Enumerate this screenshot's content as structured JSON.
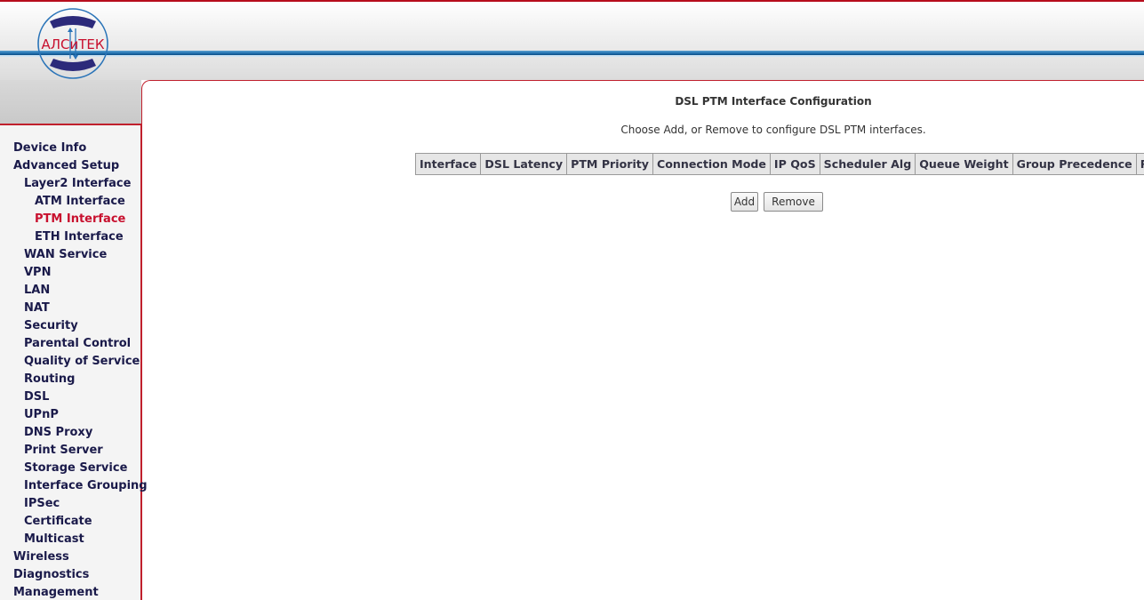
{
  "logo": {
    "text": "АЛСиТЕК",
    "icon": "telephone-handset-logo"
  },
  "colors": {
    "brand_red": "#c0202d",
    "stripe_blue": "#1f6fae",
    "menu_text": "#1a1a4a",
    "menu_active": "#c8102e"
  },
  "menu": {
    "items": [
      {
        "label": "Device Info",
        "level": 1
      },
      {
        "label": "Advanced Setup",
        "level": 1
      },
      {
        "label": "Layer2 Interface",
        "level": 2
      },
      {
        "label": "ATM Interface",
        "level": 3
      },
      {
        "label": "PTM Interface",
        "level": 3,
        "active": true
      },
      {
        "label": "ETH Interface",
        "level": 3
      },
      {
        "label": "WAN Service",
        "level": 2
      },
      {
        "label": "VPN",
        "level": 2
      },
      {
        "label": "LAN",
        "level": 2
      },
      {
        "label": "NAT",
        "level": 2
      },
      {
        "label": "Security",
        "level": 2
      },
      {
        "label": "Parental Control",
        "level": 2
      },
      {
        "label": "Quality of Service",
        "level": 2
      },
      {
        "label": "Routing",
        "level": 2
      },
      {
        "label": "DSL",
        "level": 2
      },
      {
        "label": "UPnP",
        "level": 2
      },
      {
        "label": "DNS Proxy",
        "level": 2
      },
      {
        "label": "Print Server",
        "level": 2
      },
      {
        "label": "Storage Service",
        "level": 2
      },
      {
        "label": "Interface Grouping",
        "level": 2
      },
      {
        "label": "IPSec",
        "level": 2
      },
      {
        "label": "Certificate",
        "level": 2
      },
      {
        "label": "Multicast",
        "level": 2
      },
      {
        "label": "Wireless",
        "level": 1
      },
      {
        "label": "Diagnostics",
        "level": 1
      },
      {
        "label": "Management",
        "level": 1
      }
    ]
  },
  "main": {
    "title": "DSL PTM Interface Configuration",
    "description": "Choose Add, or Remove to configure DSL PTM interfaces.",
    "table": {
      "columns": [
        "Interface",
        "DSL Latency",
        "PTM Priority",
        "Connection Mode",
        "IP QoS",
        "Scheduler Alg",
        "Queue Weight",
        "Group Precedence",
        "Remove"
      ],
      "rows": []
    },
    "buttons": {
      "add": "Add",
      "remove": "Remove"
    }
  }
}
